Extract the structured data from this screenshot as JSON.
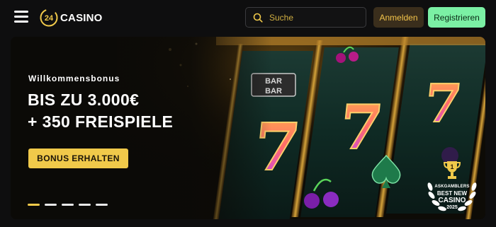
{
  "header": {
    "logo_number": "24",
    "logo_text": "CASINO",
    "search": {
      "placeholder": "Suche"
    },
    "login_label": "Anmelden",
    "register_label": "Registrieren"
  },
  "banner": {
    "eyebrow": "Willkommensbonus",
    "headline_line1": "BIS ZU 3.000€",
    "headline_line2": "+ 350 FREISPIELE",
    "cta_label": "BONUS ERHALTEN",
    "slides_count": 5,
    "active_slide": 1,
    "award": {
      "rank": "1",
      "brand": "ASKGAMBLERS",
      "line1": "BEST NEW",
      "line2": "CASINO",
      "year": "2025"
    }
  },
  "colors": {
    "accent_gold": "#f0c94a",
    "register_green": "#7bf0a4",
    "background": "#0e0e0f"
  },
  "icons": [
    "hamburger-menu-icon",
    "search-icon",
    "trophy-icon",
    "laurel-icon"
  ]
}
